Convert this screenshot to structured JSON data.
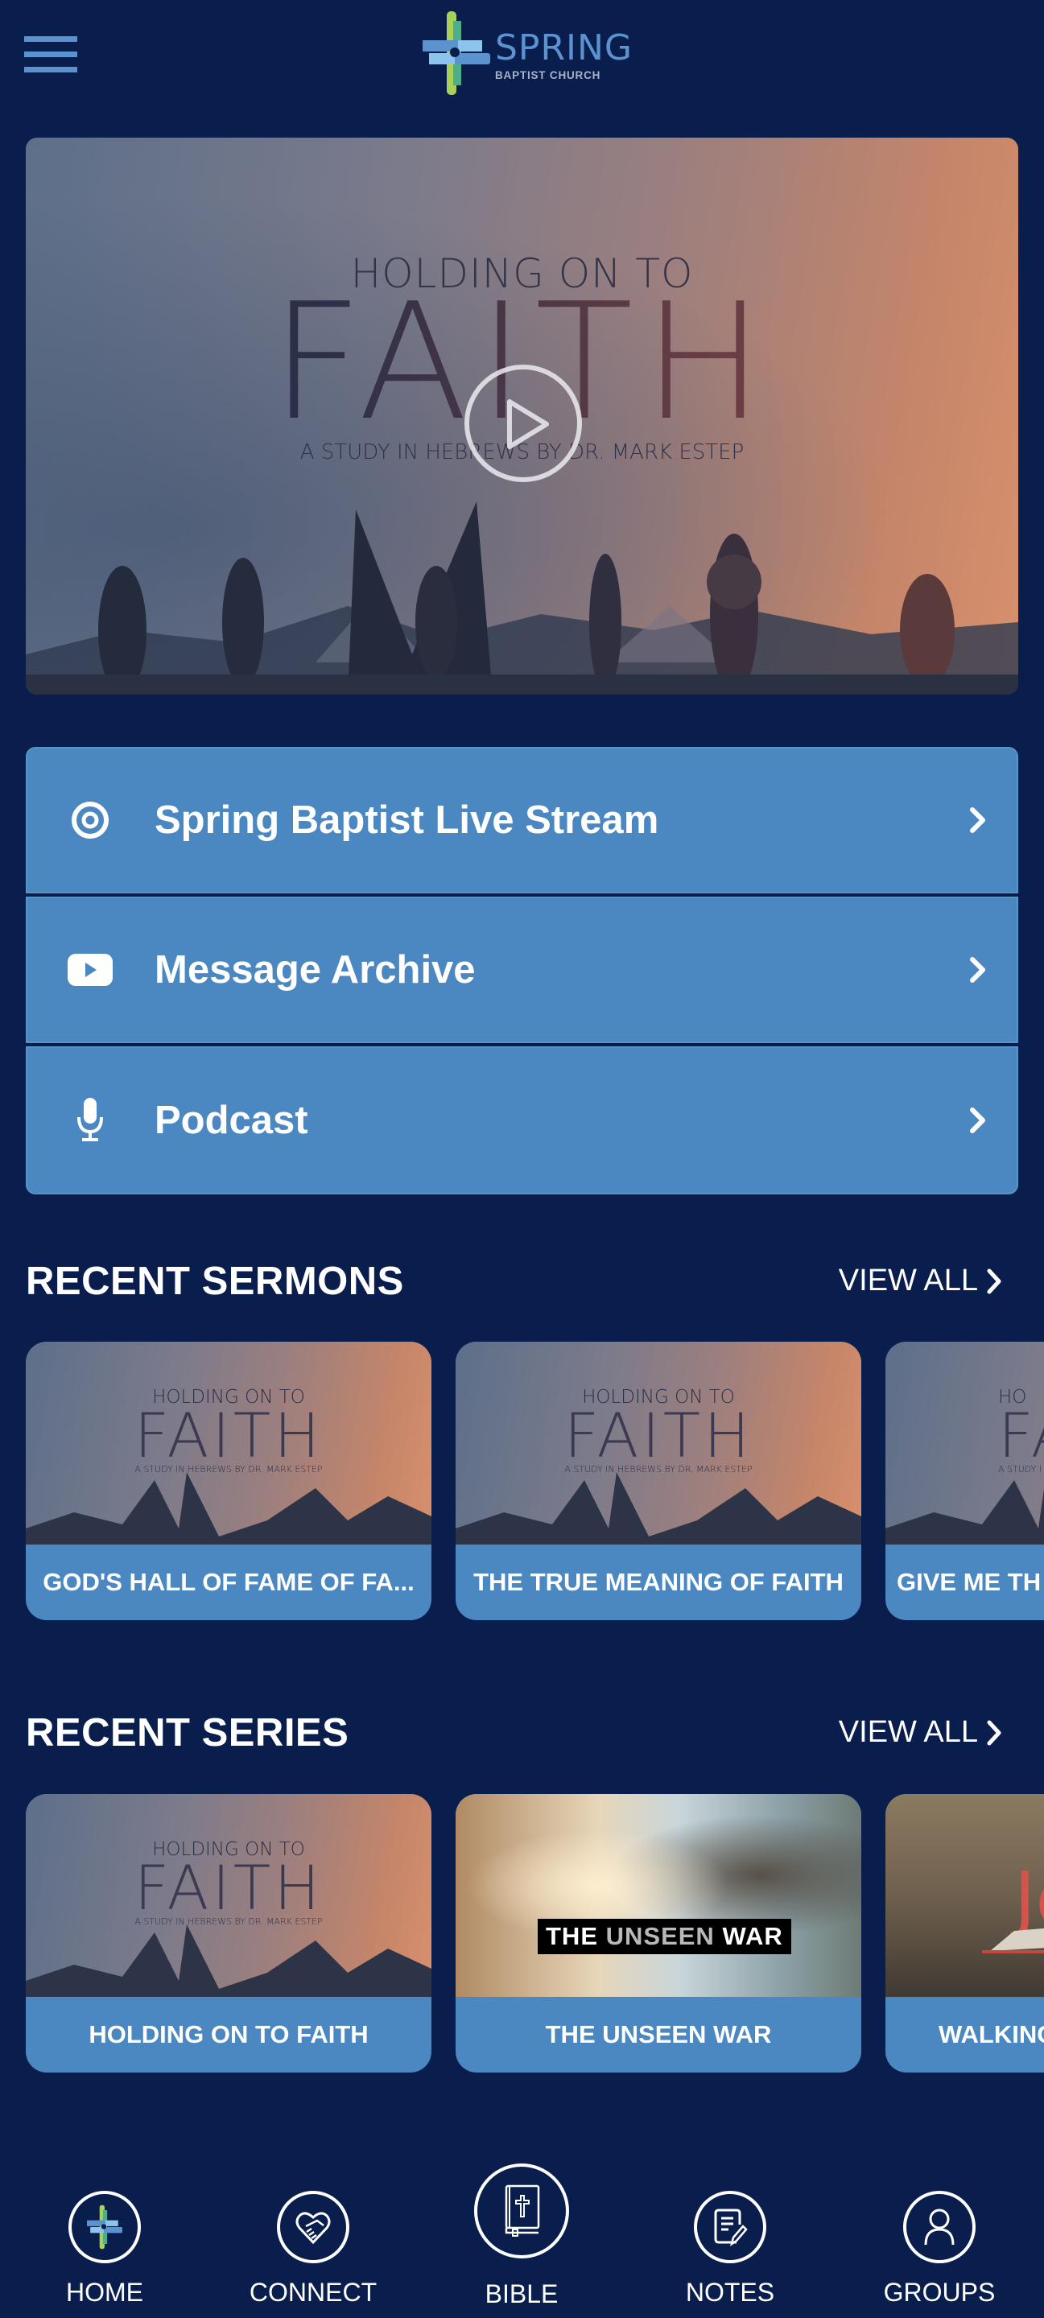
{
  "header": {
    "menu_icon": "hamburger-menu-icon",
    "logo": {
      "title": "SPRING",
      "subtitle": "BAPTIST CHURCH",
      "colors": {
        "blue": "#5a93cf",
        "light_blue": "#8cc4ee",
        "green": "#4fae8a",
        "lime": "#a8d05a",
        "grey": "#a9b3c4"
      }
    }
  },
  "hero": {
    "line1": "HOLDING ON TO",
    "line2": "FAITH",
    "line3": "A STUDY IN HEBREWS BY DR. MARK ESTEP",
    "play_icon": "play-circle-icon"
  },
  "links": [
    {
      "label": "Spring Baptist Live Stream",
      "icon": "live-stream-target-icon"
    },
    {
      "label": "Message Archive",
      "icon": "youtube-play-icon"
    },
    {
      "label": "Podcast",
      "icon": "microphone-icon"
    }
  ],
  "recent_sermons": {
    "title": "RECENT SERMONS",
    "view_all": "VIEW ALL",
    "items": [
      {
        "title": "GOD'S HALL OF FAME OF FA...",
        "art_line1": "HOLDING ON TO",
        "art_line2": "FAITH",
        "art_line3": "A STUDY IN HEBREWS BY DR. MARK ESTEP"
      },
      {
        "title": "THE TRUE MEANING OF FAITH",
        "art_line1": "HOLDING ON TO",
        "art_line2": "FAITH",
        "art_line3": "A STUDY IN HEBREWS BY DR. MARK ESTEP"
      },
      {
        "title": "GIVE ME TH",
        "art_line1": "HO",
        "art_line2": "FA",
        "art_line3": "A STUDY I"
      }
    ]
  },
  "recent_series": {
    "title": "RECENT SERIES",
    "view_all": "VIEW ALL",
    "items": [
      {
        "title": "HOLDING ON TO FAITH",
        "art_line1": "HOLDING ON TO",
        "art_line2": "FAITH",
        "art_line3": "A STUDY IN HEBREWS BY DR. MARK ESTEP"
      },
      {
        "title": "THE UNSEEN WAR",
        "art_label_a": "THE",
        "art_label_b": "UNSEEN",
        "art_label_c": "WAR"
      },
      {
        "title": "WALKING",
        "art_letter": "Jo"
      }
    ]
  },
  "bottom_nav": [
    {
      "label": "HOME",
      "icon": "home-cross-logo-icon"
    },
    {
      "label": "CONNECT",
      "icon": "handshake-heart-icon"
    },
    {
      "label": "BIBLE",
      "icon": "bible-book-icon"
    },
    {
      "label": "NOTES",
      "icon": "notes-pencil-icon"
    },
    {
      "label": "GROUPS",
      "icon": "person-icon"
    }
  ],
  "colors": {
    "background": "#0a1e4e",
    "panel_blue": "#4b87c0",
    "text": "#ffffff"
  }
}
